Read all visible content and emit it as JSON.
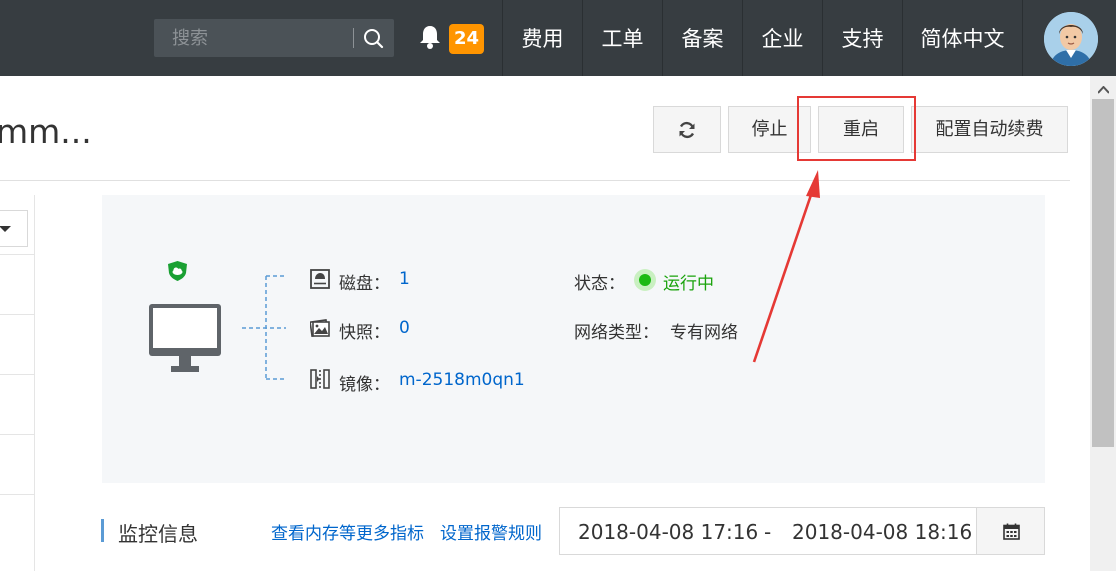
{
  "topbar": {
    "search_placeholder": "搜索",
    "notification_count": "24",
    "nav": [
      "费用",
      "工单",
      "备案",
      "企业",
      "支持",
      "简体中文"
    ]
  },
  "header": {
    "title": "mm...",
    "refresh_icon": "refresh-icon",
    "stop_label": "停止",
    "restart_label": "重启",
    "auto_renew_label": "配置自动续费"
  },
  "instance": {
    "disk_label": "磁盘：",
    "disk_value": "1",
    "snapshot_label": "快照：",
    "snapshot_value": "0",
    "image_label": "镜像：",
    "image_value": "m-2518m0qn1",
    "status_label": "状态：",
    "status_value": "运行中",
    "network_label": "网络类型：",
    "network_value": "专有网络"
  },
  "monitor": {
    "title": "监控信息",
    "link_more": "查看内存等更多指标",
    "link_alarm": "设置报警规则",
    "start_time": "2018-04-08 17:16",
    "separator": "-",
    "end_time": "2018-04-08 18:16"
  },
  "colors": {
    "topbar": "#373d41",
    "badge": "#ff9500",
    "link": "#0066cc",
    "running": "#1aa30c",
    "highlight": "#e53935"
  }
}
